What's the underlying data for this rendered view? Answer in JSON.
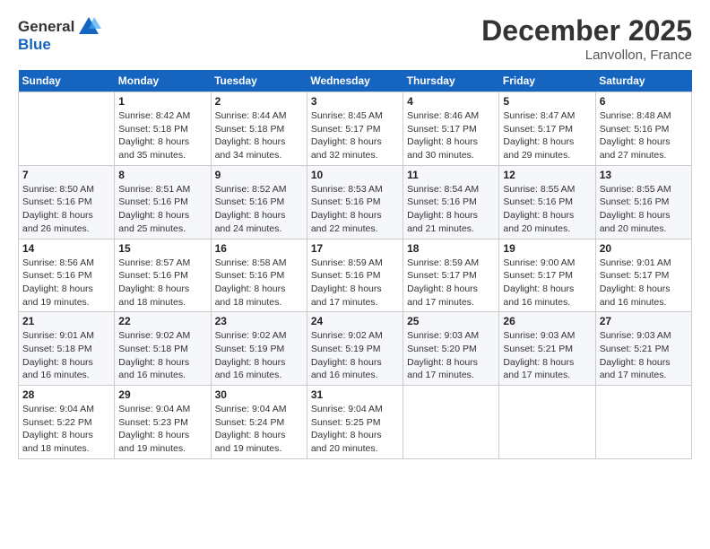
{
  "header": {
    "logo_general": "General",
    "logo_blue": "Blue",
    "month": "December 2025",
    "location": "Lanvollon, France"
  },
  "weekdays": [
    "Sunday",
    "Monday",
    "Tuesday",
    "Wednesday",
    "Thursday",
    "Friday",
    "Saturday"
  ],
  "weeks": [
    [
      {
        "day": "",
        "info": ""
      },
      {
        "day": "1",
        "info": "Sunrise: 8:42 AM\nSunset: 5:18 PM\nDaylight: 8 hours\nand 35 minutes."
      },
      {
        "day": "2",
        "info": "Sunrise: 8:44 AM\nSunset: 5:18 PM\nDaylight: 8 hours\nand 34 minutes."
      },
      {
        "day": "3",
        "info": "Sunrise: 8:45 AM\nSunset: 5:17 PM\nDaylight: 8 hours\nand 32 minutes."
      },
      {
        "day": "4",
        "info": "Sunrise: 8:46 AM\nSunset: 5:17 PM\nDaylight: 8 hours\nand 30 minutes."
      },
      {
        "day": "5",
        "info": "Sunrise: 8:47 AM\nSunset: 5:17 PM\nDaylight: 8 hours\nand 29 minutes."
      },
      {
        "day": "6",
        "info": "Sunrise: 8:48 AM\nSunset: 5:16 PM\nDaylight: 8 hours\nand 27 minutes."
      }
    ],
    [
      {
        "day": "7",
        "info": "Sunrise: 8:50 AM\nSunset: 5:16 PM\nDaylight: 8 hours\nand 26 minutes."
      },
      {
        "day": "8",
        "info": "Sunrise: 8:51 AM\nSunset: 5:16 PM\nDaylight: 8 hours\nand 25 minutes."
      },
      {
        "day": "9",
        "info": "Sunrise: 8:52 AM\nSunset: 5:16 PM\nDaylight: 8 hours\nand 24 minutes."
      },
      {
        "day": "10",
        "info": "Sunrise: 8:53 AM\nSunset: 5:16 PM\nDaylight: 8 hours\nand 22 minutes."
      },
      {
        "day": "11",
        "info": "Sunrise: 8:54 AM\nSunset: 5:16 PM\nDaylight: 8 hours\nand 21 minutes."
      },
      {
        "day": "12",
        "info": "Sunrise: 8:55 AM\nSunset: 5:16 PM\nDaylight: 8 hours\nand 20 minutes."
      },
      {
        "day": "13",
        "info": "Sunrise: 8:55 AM\nSunset: 5:16 PM\nDaylight: 8 hours\nand 20 minutes."
      }
    ],
    [
      {
        "day": "14",
        "info": "Sunrise: 8:56 AM\nSunset: 5:16 PM\nDaylight: 8 hours\nand 19 minutes."
      },
      {
        "day": "15",
        "info": "Sunrise: 8:57 AM\nSunset: 5:16 PM\nDaylight: 8 hours\nand 18 minutes."
      },
      {
        "day": "16",
        "info": "Sunrise: 8:58 AM\nSunset: 5:16 PM\nDaylight: 8 hours\nand 18 minutes."
      },
      {
        "day": "17",
        "info": "Sunrise: 8:59 AM\nSunset: 5:16 PM\nDaylight: 8 hours\nand 17 minutes."
      },
      {
        "day": "18",
        "info": "Sunrise: 8:59 AM\nSunset: 5:17 PM\nDaylight: 8 hours\nand 17 minutes."
      },
      {
        "day": "19",
        "info": "Sunrise: 9:00 AM\nSunset: 5:17 PM\nDaylight: 8 hours\nand 16 minutes."
      },
      {
        "day": "20",
        "info": "Sunrise: 9:01 AM\nSunset: 5:17 PM\nDaylight: 8 hours\nand 16 minutes."
      }
    ],
    [
      {
        "day": "21",
        "info": "Sunrise: 9:01 AM\nSunset: 5:18 PM\nDaylight: 8 hours\nand 16 minutes."
      },
      {
        "day": "22",
        "info": "Sunrise: 9:02 AM\nSunset: 5:18 PM\nDaylight: 8 hours\nand 16 minutes."
      },
      {
        "day": "23",
        "info": "Sunrise: 9:02 AM\nSunset: 5:19 PM\nDaylight: 8 hours\nand 16 minutes."
      },
      {
        "day": "24",
        "info": "Sunrise: 9:02 AM\nSunset: 5:19 PM\nDaylight: 8 hours\nand 16 minutes."
      },
      {
        "day": "25",
        "info": "Sunrise: 9:03 AM\nSunset: 5:20 PM\nDaylight: 8 hours\nand 17 minutes."
      },
      {
        "day": "26",
        "info": "Sunrise: 9:03 AM\nSunset: 5:21 PM\nDaylight: 8 hours\nand 17 minutes."
      },
      {
        "day": "27",
        "info": "Sunrise: 9:03 AM\nSunset: 5:21 PM\nDaylight: 8 hours\nand 17 minutes."
      }
    ],
    [
      {
        "day": "28",
        "info": "Sunrise: 9:04 AM\nSunset: 5:22 PM\nDaylight: 8 hours\nand 18 minutes."
      },
      {
        "day": "29",
        "info": "Sunrise: 9:04 AM\nSunset: 5:23 PM\nDaylight: 8 hours\nand 19 minutes."
      },
      {
        "day": "30",
        "info": "Sunrise: 9:04 AM\nSunset: 5:24 PM\nDaylight: 8 hours\nand 19 minutes."
      },
      {
        "day": "31",
        "info": "Sunrise: 9:04 AM\nSunset: 5:25 PM\nDaylight: 8 hours\nand 20 minutes."
      },
      {
        "day": "",
        "info": ""
      },
      {
        "day": "",
        "info": ""
      },
      {
        "day": "",
        "info": ""
      }
    ]
  ]
}
